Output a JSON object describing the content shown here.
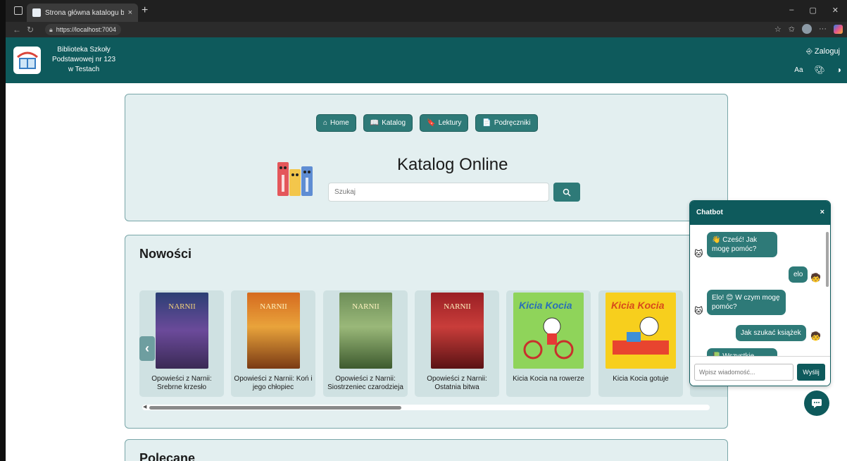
{
  "browser": {
    "tab_title": "Strona główna katalogu bibliotek",
    "tab_close": "×",
    "new_tab": "+",
    "url": "https://localhost:7004",
    "window_controls": [
      "–",
      "▢",
      "✕"
    ]
  },
  "header": {
    "school_line1": "Biblioteka Szkoły",
    "school_line2": "Podstawowej nr 123",
    "school_line3": "w Testach",
    "login_label": "Zaloguj",
    "font_size_label": "Aa",
    "icons": [
      "palette-icon",
      "contrast-icon"
    ]
  },
  "hero": {
    "nav": [
      {
        "icon": "⌂",
        "label": "Home"
      },
      {
        "icon": "📖",
        "label": "Katalog"
      },
      {
        "icon": "🔖",
        "label": "Lektury"
      },
      {
        "icon": "📄",
        "label": "Podręczniki"
      }
    ],
    "title": "Katalog Online",
    "search_placeholder": "Szukaj"
  },
  "news": {
    "title": "Nowości",
    "prev_label": "‹",
    "books": [
      {
        "title": "Opowieści z Narnii: Srebrne krzesło",
        "cover_color": "#5a3f7a"
      },
      {
        "title": "Opowieści z Narnii: Koń i jego chłopiec",
        "cover_color": "#c45a1e"
      },
      {
        "title": "Opowieści z Narnii: Siostrzeniec czarodzieja",
        "cover_color": "#5d8a4a"
      },
      {
        "title": "Opowieści z Narnii: Ostatnia bitwa",
        "cover_color": "#8b1e22"
      },
      {
        "title": "Kicia Kocia na rowerze",
        "cover_color": "#7ec94f"
      },
      {
        "title": "Kicia Kocia gotuje",
        "cover_color": "#f3c91b"
      }
    ],
    "scroll_fraction": 0.45
  },
  "recommended": {
    "title": "Polecane"
  },
  "chatbot": {
    "title": "Chatbot",
    "close": "×",
    "messages": [
      {
        "from": "bot",
        "text": "👋 Cześć! Jak mogę pomóc?"
      },
      {
        "from": "user",
        "text": "elo"
      },
      {
        "from": "bot",
        "text": "Elo! 😊 W czym mogę pomóc?"
      },
      {
        "from": "user",
        "text": "Jak szukać książek"
      },
      {
        "from": "bot",
        "text": "📗 Wszystkie książki"
      }
    ],
    "input_placeholder": "Wpisz wiadomość...",
    "send_label": "Wyślij"
  }
}
